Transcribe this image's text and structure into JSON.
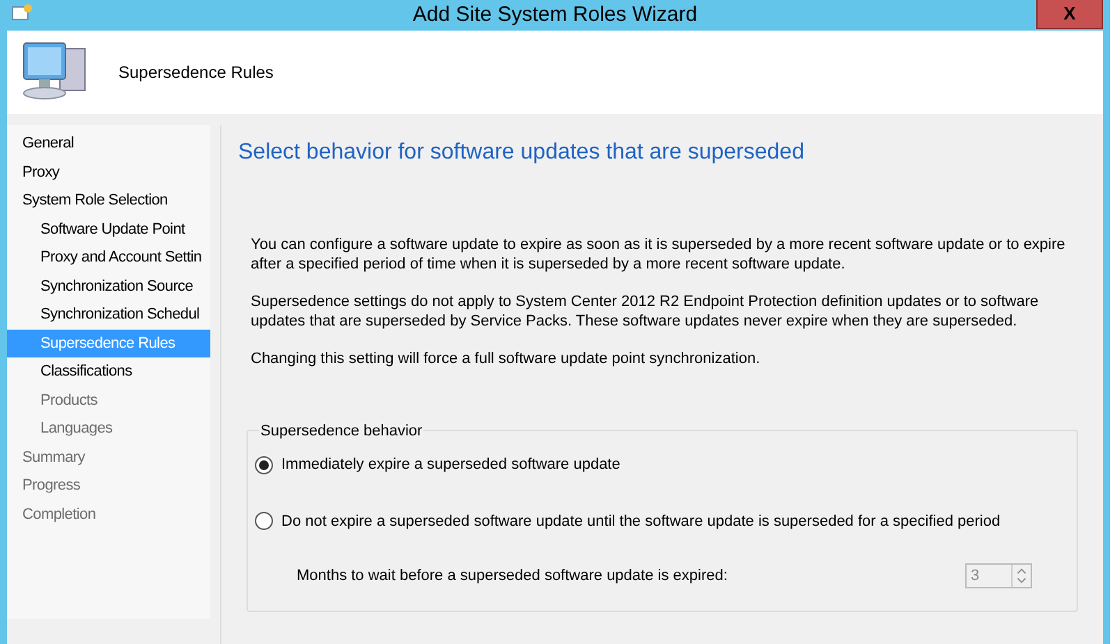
{
  "window": {
    "title": "Add Site System Roles Wizard",
    "close": "X"
  },
  "header": {
    "title": "Supersedence Rules"
  },
  "sidebar": {
    "items": [
      {
        "label": "General",
        "selected": false,
        "disabled": false
      },
      {
        "label": "Proxy",
        "selected": false,
        "disabled": false
      },
      {
        "label": "System Role Selection",
        "selected": false,
        "disabled": false,
        "children": [
          {
            "label": "Software Update Point",
            "selected": false,
            "disabled": false
          },
          {
            "label": "Proxy and Account Settin",
            "selected": false,
            "disabled": false
          },
          {
            "label": "Synchronization Source",
            "selected": false,
            "disabled": false
          },
          {
            "label": "Synchronization Schedul",
            "selected": false,
            "disabled": false
          },
          {
            "label": "Supersedence Rules",
            "selected": true,
            "disabled": false
          },
          {
            "label": "Classifications",
            "selected": false,
            "disabled": false
          },
          {
            "label": "Products",
            "selected": false,
            "disabled": true
          },
          {
            "label": "Languages",
            "selected": false,
            "disabled": true
          }
        ]
      },
      {
        "label": "Summary",
        "selected": false,
        "disabled": true
      },
      {
        "label": "Progress",
        "selected": false,
        "disabled": true
      },
      {
        "label": "Completion",
        "selected": false,
        "disabled": true
      }
    ]
  },
  "page": {
    "heading": "Select behavior for software updates that are superseded",
    "paragraphs": [
      "You can configure a software update to expire as soon as it is superseded by a more recent software update or to expire after a specified period of time when it is superseded by a more recent software update.",
      "Supersedence settings do not apply to System Center 2012 R2 Endpoint Protection definition updates or to software updates that are superseded by Service Packs. These software updates never expire when they are superseded.",
      "Changing this setting will force a full software update point synchronization."
    ],
    "group": {
      "title": "Supersedence behavior",
      "options": [
        {
          "label": "Immediately expire a superseded software update",
          "selected": true
        },
        {
          "label": "Do not expire a superseded software update until the software update is superseded for a specified period",
          "selected": false
        }
      ],
      "months_label": "Months to wait before a superseded software update is expired:",
      "months_value": "3",
      "months_disabled": true
    }
  }
}
